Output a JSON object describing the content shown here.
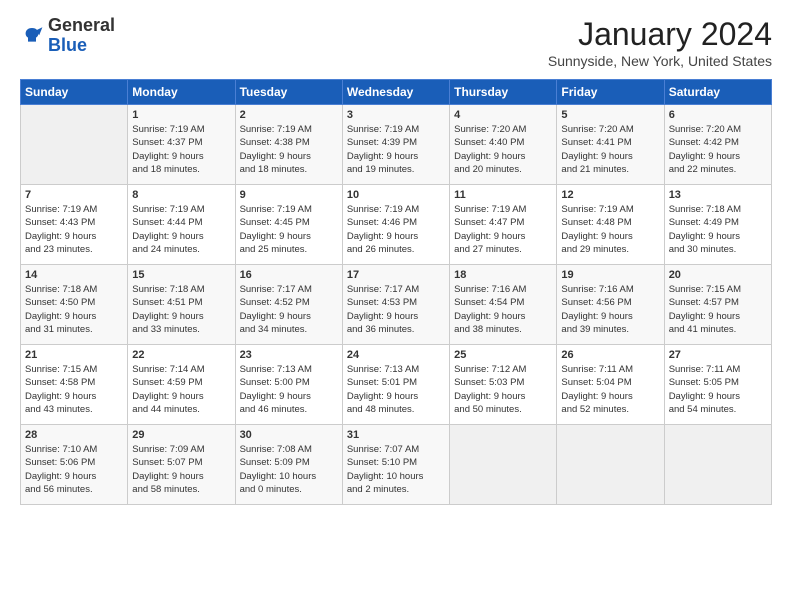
{
  "header": {
    "logo": {
      "general": "General",
      "blue": "Blue"
    },
    "title": "January 2024",
    "subtitle": "Sunnyside, New York, United States"
  },
  "days_of_week": [
    "Sunday",
    "Monday",
    "Tuesday",
    "Wednesday",
    "Thursday",
    "Friday",
    "Saturday"
  ],
  "weeks": [
    [
      {
        "day": "",
        "lines": []
      },
      {
        "day": "1",
        "lines": [
          "Sunrise: 7:19 AM",
          "Sunset: 4:37 PM",
          "Daylight: 9 hours",
          "and 18 minutes."
        ]
      },
      {
        "day": "2",
        "lines": [
          "Sunrise: 7:19 AM",
          "Sunset: 4:38 PM",
          "Daylight: 9 hours",
          "and 18 minutes."
        ]
      },
      {
        "day": "3",
        "lines": [
          "Sunrise: 7:19 AM",
          "Sunset: 4:39 PM",
          "Daylight: 9 hours",
          "and 19 minutes."
        ]
      },
      {
        "day": "4",
        "lines": [
          "Sunrise: 7:20 AM",
          "Sunset: 4:40 PM",
          "Daylight: 9 hours",
          "and 20 minutes."
        ]
      },
      {
        "day": "5",
        "lines": [
          "Sunrise: 7:20 AM",
          "Sunset: 4:41 PM",
          "Daylight: 9 hours",
          "and 21 minutes."
        ]
      },
      {
        "day": "6",
        "lines": [
          "Sunrise: 7:20 AM",
          "Sunset: 4:42 PM",
          "Daylight: 9 hours",
          "and 22 minutes."
        ]
      }
    ],
    [
      {
        "day": "7",
        "lines": [
          "Sunrise: 7:19 AM",
          "Sunset: 4:43 PM",
          "Daylight: 9 hours",
          "and 23 minutes."
        ]
      },
      {
        "day": "8",
        "lines": [
          "Sunrise: 7:19 AM",
          "Sunset: 4:44 PM",
          "Daylight: 9 hours",
          "and 24 minutes."
        ]
      },
      {
        "day": "9",
        "lines": [
          "Sunrise: 7:19 AM",
          "Sunset: 4:45 PM",
          "Daylight: 9 hours",
          "and 25 minutes."
        ]
      },
      {
        "day": "10",
        "lines": [
          "Sunrise: 7:19 AM",
          "Sunset: 4:46 PM",
          "Daylight: 9 hours",
          "and 26 minutes."
        ]
      },
      {
        "day": "11",
        "lines": [
          "Sunrise: 7:19 AM",
          "Sunset: 4:47 PM",
          "Daylight: 9 hours",
          "and 27 minutes."
        ]
      },
      {
        "day": "12",
        "lines": [
          "Sunrise: 7:19 AM",
          "Sunset: 4:48 PM",
          "Daylight: 9 hours",
          "and 29 minutes."
        ]
      },
      {
        "day": "13",
        "lines": [
          "Sunrise: 7:18 AM",
          "Sunset: 4:49 PM",
          "Daylight: 9 hours",
          "and 30 minutes."
        ]
      }
    ],
    [
      {
        "day": "14",
        "lines": [
          "Sunrise: 7:18 AM",
          "Sunset: 4:50 PM",
          "Daylight: 9 hours",
          "and 31 minutes."
        ]
      },
      {
        "day": "15",
        "lines": [
          "Sunrise: 7:18 AM",
          "Sunset: 4:51 PM",
          "Daylight: 9 hours",
          "and 33 minutes."
        ]
      },
      {
        "day": "16",
        "lines": [
          "Sunrise: 7:17 AM",
          "Sunset: 4:52 PM",
          "Daylight: 9 hours",
          "and 34 minutes."
        ]
      },
      {
        "day": "17",
        "lines": [
          "Sunrise: 7:17 AM",
          "Sunset: 4:53 PM",
          "Daylight: 9 hours",
          "and 36 minutes."
        ]
      },
      {
        "day": "18",
        "lines": [
          "Sunrise: 7:16 AM",
          "Sunset: 4:54 PM",
          "Daylight: 9 hours",
          "and 38 minutes."
        ]
      },
      {
        "day": "19",
        "lines": [
          "Sunrise: 7:16 AM",
          "Sunset: 4:56 PM",
          "Daylight: 9 hours",
          "and 39 minutes."
        ]
      },
      {
        "day": "20",
        "lines": [
          "Sunrise: 7:15 AM",
          "Sunset: 4:57 PM",
          "Daylight: 9 hours",
          "and 41 minutes."
        ]
      }
    ],
    [
      {
        "day": "21",
        "lines": [
          "Sunrise: 7:15 AM",
          "Sunset: 4:58 PM",
          "Daylight: 9 hours",
          "and 43 minutes."
        ]
      },
      {
        "day": "22",
        "lines": [
          "Sunrise: 7:14 AM",
          "Sunset: 4:59 PM",
          "Daylight: 9 hours",
          "and 44 minutes."
        ]
      },
      {
        "day": "23",
        "lines": [
          "Sunrise: 7:13 AM",
          "Sunset: 5:00 PM",
          "Daylight: 9 hours",
          "and 46 minutes."
        ]
      },
      {
        "day": "24",
        "lines": [
          "Sunrise: 7:13 AM",
          "Sunset: 5:01 PM",
          "Daylight: 9 hours",
          "and 48 minutes."
        ]
      },
      {
        "day": "25",
        "lines": [
          "Sunrise: 7:12 AM",
          "Sunset: 5:03 PM",
          "Daylight: 9 hours",
          "and 50 minutes."
        ]
      },
      {
        "day": "26",
        "lines": [
          "Sunrise: 7:11 AM",
          "Sunset: 5:04 PM",
          "Daylight: 9 hours",
          "and 52 minutes."
        ]
      },
      {
        "day": "27",
        "lines": [
          "Sunrise: 7:11 AM",
          "Sunset: 5:05 PM",
          "Daylight: 9 hours",
          "and 54 minutes."
        ]
      }
    ],
    [
      {
        "day": "28",
        "lines": [
          "Sunrise: 7:10 AM",
          "Sunset: 5:06 PM",
          "Daylight: 9 hours",
          "and 56 minutes."
        ]
      },
      {
        "day": "29",
        "lines": [
          "Sunrise: 7:09 AM",
          "Sunset: 5:07 PM",
          "Daylight: 9 hours",
          "and 58 minutes."
        ]
      },
      {
        "day": "30",
        "lines": [
          "Sunrise: 7:08 AM",
          "Sunset: 5:09 PM",
          "Daylight: 10 hours",
          "and 0 minutes."
        ]
      },
      {
        "day": "31",
        "lines": [
          "Sunrise: 7:07 AM",
          "Sunset: 5:10 PM",
          "Daylight: 10 hours",
          "and 2 minutes."
        ]
      },
      {
        "day": "",
        "lines": []
      },
      {
        "day": "",
        "lines": []
      },
      {
        "day": "",
        "lines": []
      }
    ]
  ]
}
